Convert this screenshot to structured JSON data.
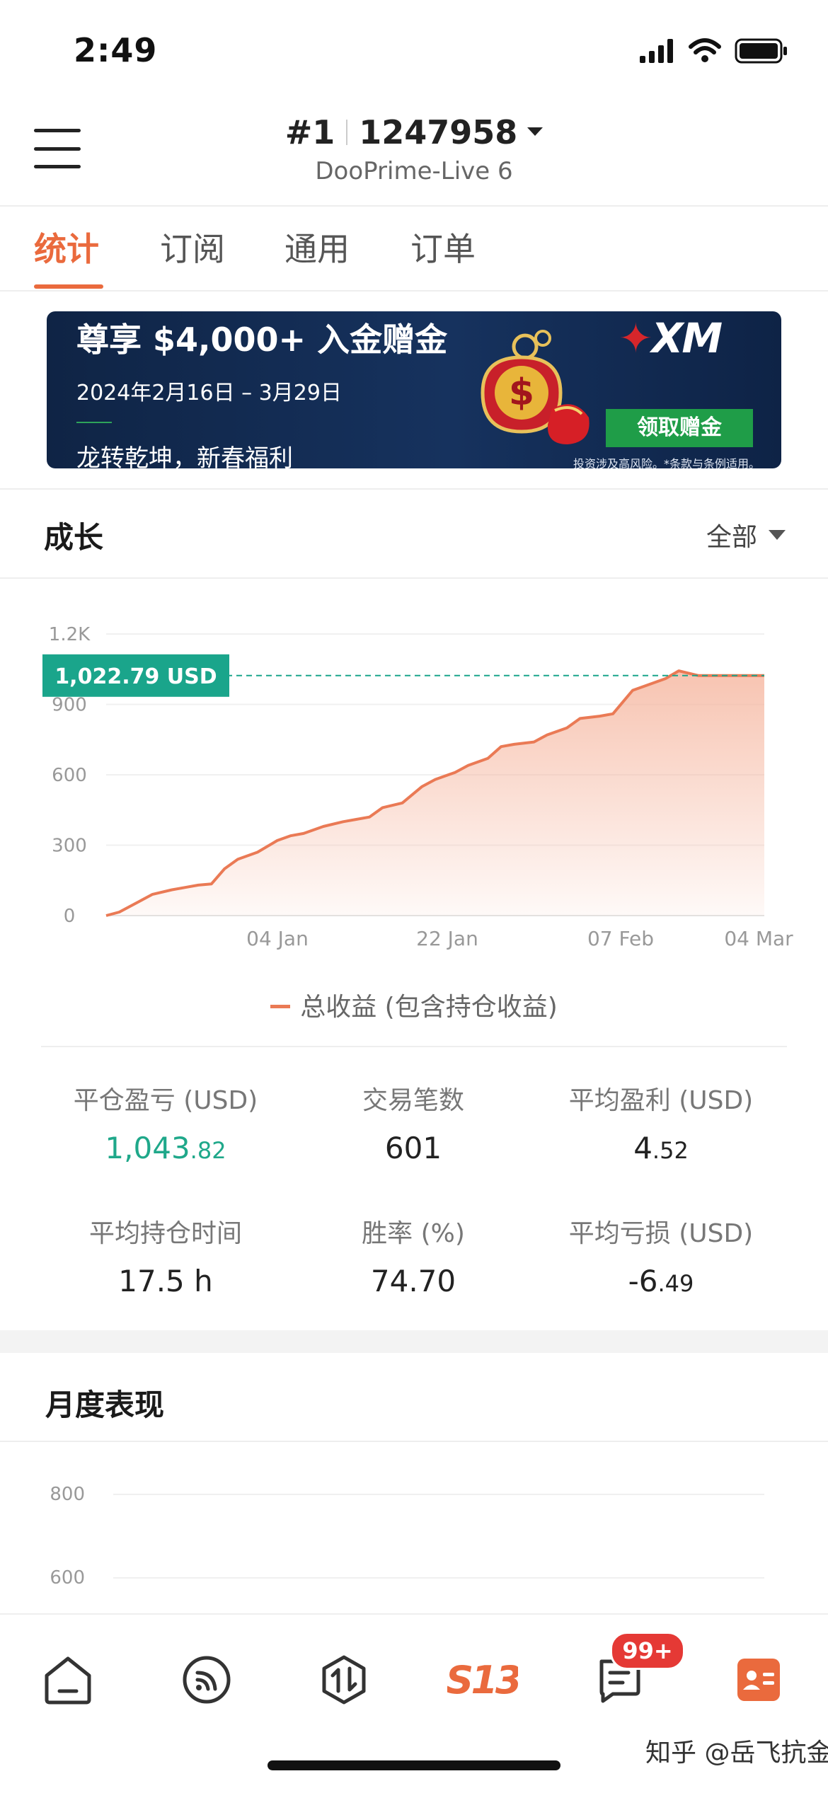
{
  "status_bar": {
    "time": "2:49"
  },
  "header": {
    "account_number": "#1",
    "account_id": "1247958",
    "server": "DooPrime-Live 6"
  },
  "tabs": [
    {
      "label": "统计",
      "active": true
    },
    {
      "label": "订阅",
      "active": false
    },
    {
      "label": "通用",
      "active": false
    },
    {
      "label": "订单",
      "active": false
    }
  ],
  "banner": {
    "title": "尊享 $4,000+ 入金赠金",
    "date": "2024年2月16日 – 3月29日",
    "slogan": "龙转乾坤，新春福利",
    "brand": "XM",
    "cta": "领取赠金",
    "disclaimer": "投资涉及高风险。*条款与条例适用。"
  },
  "growth": {
    "title": "成长",
    "range": "全部",
    "current_label": "1,022.79 USD",
    "legend": "总收益 (包含持仓收益)"
  },
  "chart_data": {
    "type": "area",
    "series": [
      {
        "name": "总收益 (包含持仓收益)",
        "x": [
          0,
          2,
          5,
          7,
          10,
          12,
          14,
          16,
          18,
          20,
          23,
          26,
          28,
          30,
          33,
          36,
          38,
          40,
          42,
          45,
          48,
          50,
          53,
          55,
          58,
          60,
          62,
          65,
          67,
          70,
          72,
          75,
          77,
          80,
          82,
          85,
          87,
          90,
          92,
          95,
          97,
          100
        ],
        "values": [
          0,
          15,
          60,
          90,
          110,
          120,
          130,
          135,
          200,
          240,
          270,
          320,
          340,
          350,
          380,
          400,
          410,
          420,
          460,
          480,
          550,
          580,
          610,
          640,
          670,
          720,
          730,
          740,
          770,
          800,
          840,
          850,
          860,
          960,
          980,
          1010,
          1043,
          1022.79,
          1022.79,
          1022.79,
          1022.79,
          1022.79
        ]
      }
    ],
    "xtick_labels": [
      "04 Jan",
      "22 Jan",
      "07 Feb",
      "04 Mar"
    ],
    "ytick_labels": [
      "0",
      "300",
      "600",
      "900",
      "1.2K"
    ],
    "ylim": [
      0,
      1200
    ],
    "grid": true,
    "current_value": 1022.79,
    "colors": {
      "line": "#ea7a55",
      "fill": "#f6b9a3",
      "marker": "#1aa58b"
    }
  },
  "stats": [
    {
      "label": "平仓盈亏 (USD)",
      "int": "1,043",
      "dec": ".82",
      "color": "green"
    },
    {
      "label": "交易笔数",
      "int": "601",
      "dec": ""
    },
    {
      "label": "平均盈利 (USD)",
      "int": "4",
      "dec": ".52"
    },
    {
      "label": "平均持仓时间",
      "int": "17.5 h",
      "dec": ""
    },
    {
      "label": "胜率 (%)",
      "int": "74.70",
      "dec": ""
    },
    {
      "label": "平均亏损 (USD)",
      "int": "-6",
      "dec": ".49"
    }
  ],
  "monthly": {
    "title": "月度表现",
    "ytick_labels": [
      "800",
      "600"
    ]
  },
  "bottom_nav": {
    "items": [
      {
        "icon": "home-icon"
      },
      {
        "icon": "feed-icon"
      },
      {
        "icon": "trade-icon"
      },
      {
        "icon": "s13-logo",
        "label": "S13"
      },
      {
        "icon": "messages-icon"
      },
      {
        "icon": "profile-card-icon"
      }
    ],
    "badge": "99+"
  },
  "watermark": "知乎 @岳飞抗金"
}
